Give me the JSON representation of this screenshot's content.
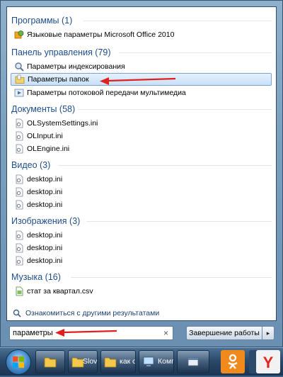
{
  "groups": [
    {
      "header": "Программы (1)",
      "items": [
        "Языковые параметры Microsoft Office 2010"
      ]
    },
    {
      "header": "Панель управления (79)",
      "items": [
        "Параметры индексирования",
        "Параметры папок",
        "Параметры потоковой передачи мультимедиа"
      ]
    },
    {
      "header": "Документы (58)",
      "items": [
        "OLSystemSettings.ini",
        "OLInput.ini",
        "OLEngine.ini"
      ]
    },
    {
      "header": "Видео (3)",
      "items": [
        "desktop.ini",
        "desktop.ini",
        "desktop.ini"
      ]
    },
    {
      "header": "Изображения (3)",
      "items": [
        "desktop.ini",
        "desktop.ini",
        "desktop.ini"
      ]
    },
    {
      "header": "Музыка (16)",
      "items": [
        "стат за квартал.csv"
      ]
    }
  ],
  "see_more": "Ознакомиться с другими результатами",
  "search": {
    "value": "параметры",
    "clear": "×"
  },
  "shutdown": {
    "label": "Завершение работы",
    "arrow": "▸"
  },
  "taskbar": {
    "buttons": [
      "SlovoEB",
      "как ото...",
      "Компь..."
    ]
  },
  "colors": {
    "header": "#1e4e8c",
    "annotation_arrow": "#e0201e",
    "selection": "#c7e0f8"
  }
}
